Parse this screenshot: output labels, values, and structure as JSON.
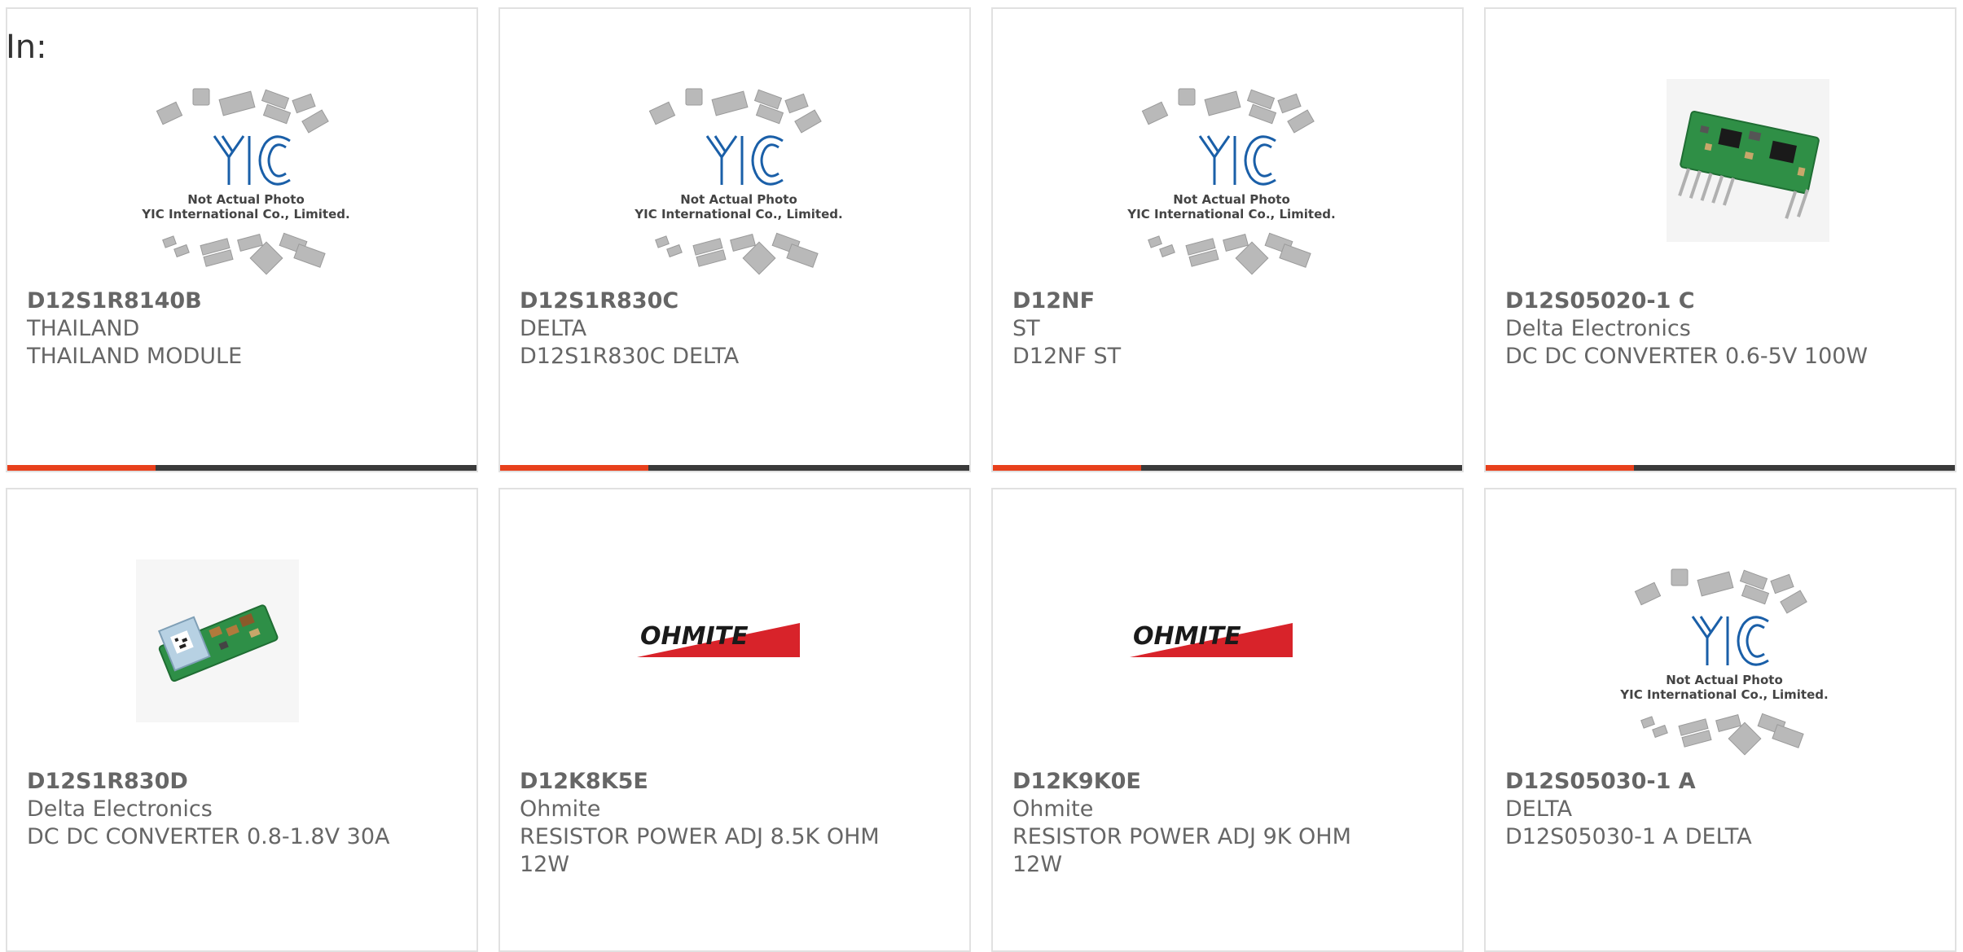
{
  "header": {
    "in_label": "In:"
  },
  "colors": {
    "accent": "#e8401c",
    "bar": "#3a3a3a",
    "text": "#666666",
    "border": "#e1e1e1",
    "yic_logo": "#1a5fa8",
    "ohmite_red": "#d8232a"
  },
  "products": [
    {
      "part_number": "D12S1R8140B",
      "manufacturer": "THAILAND",
      "description": "THAILAND MODULE",
      "image": "yic-placeholder",
      "placeholder_text_1": "Not Actual Photo",
      "placeholder_text_2": "YIC International Co., Limited."
    },
    {
      "part_number": "D12S1R830C",
      "manufacturer": "DELTA",
      "description": "D12S1R830C DELTA",
      "image": "yic-placeholder",
      "placeholder_text_1": "Not Actual Photo",
      "placeholder_text_2": "YIC International Co., Limited."
    },
    {
      "part_number": "D12NF",
      "manufacturer": "ST",
      "description": "D12NF ST",
      "image": "yic-placeholder",
      "placeholder_text_1": "Not Actual Photo",
      "placeholder_text_2": "YIC International Co., Limited."
    },
    {
      "part_number": "D12S05020-1 C",
      "manufacturer": "Delta Electronics",
      "description": "DC DC CONVERTER 0.6-5V 100W",
      "image": "green-pcb-module"
    },
    {
      "part_number": "D12S1R830D",
      "manufacturer": "Delta Electronics",
      "description": "DC DC CONVERTER 0.8-1.8V 30A",
      "image": "small-pcb-module"
    },
    {
      "part_number": "D12K8K5E",
      "manufacturer": "Ohmite",
      "description": "RESISTOR POWER ADJ 8.5K OHM 12W",
      "image": "ohmite-logo",
      "logo_text": "OHMITE"
    },
    {
      "part_number": "D12K9K0E",
      "manufacturer": "Ohmite",
      "description": "RESISTOR POWER ADJ 9K OHM 12W",
      "image": "ohmite-logo",
      "logo_text": "OHMITE"
    },
    {
      "part_number": "D12S05030-1 A",
      "manufacturer": "DELTA",
      "description": "D12S05030-1 A DELTA",
      "image": "yic-placeholder",
      "placeholder_text_1": "Not Actual Photo",
      "placeholder_text_2": "YIC International Co., Limited."
    }
  ]
}
